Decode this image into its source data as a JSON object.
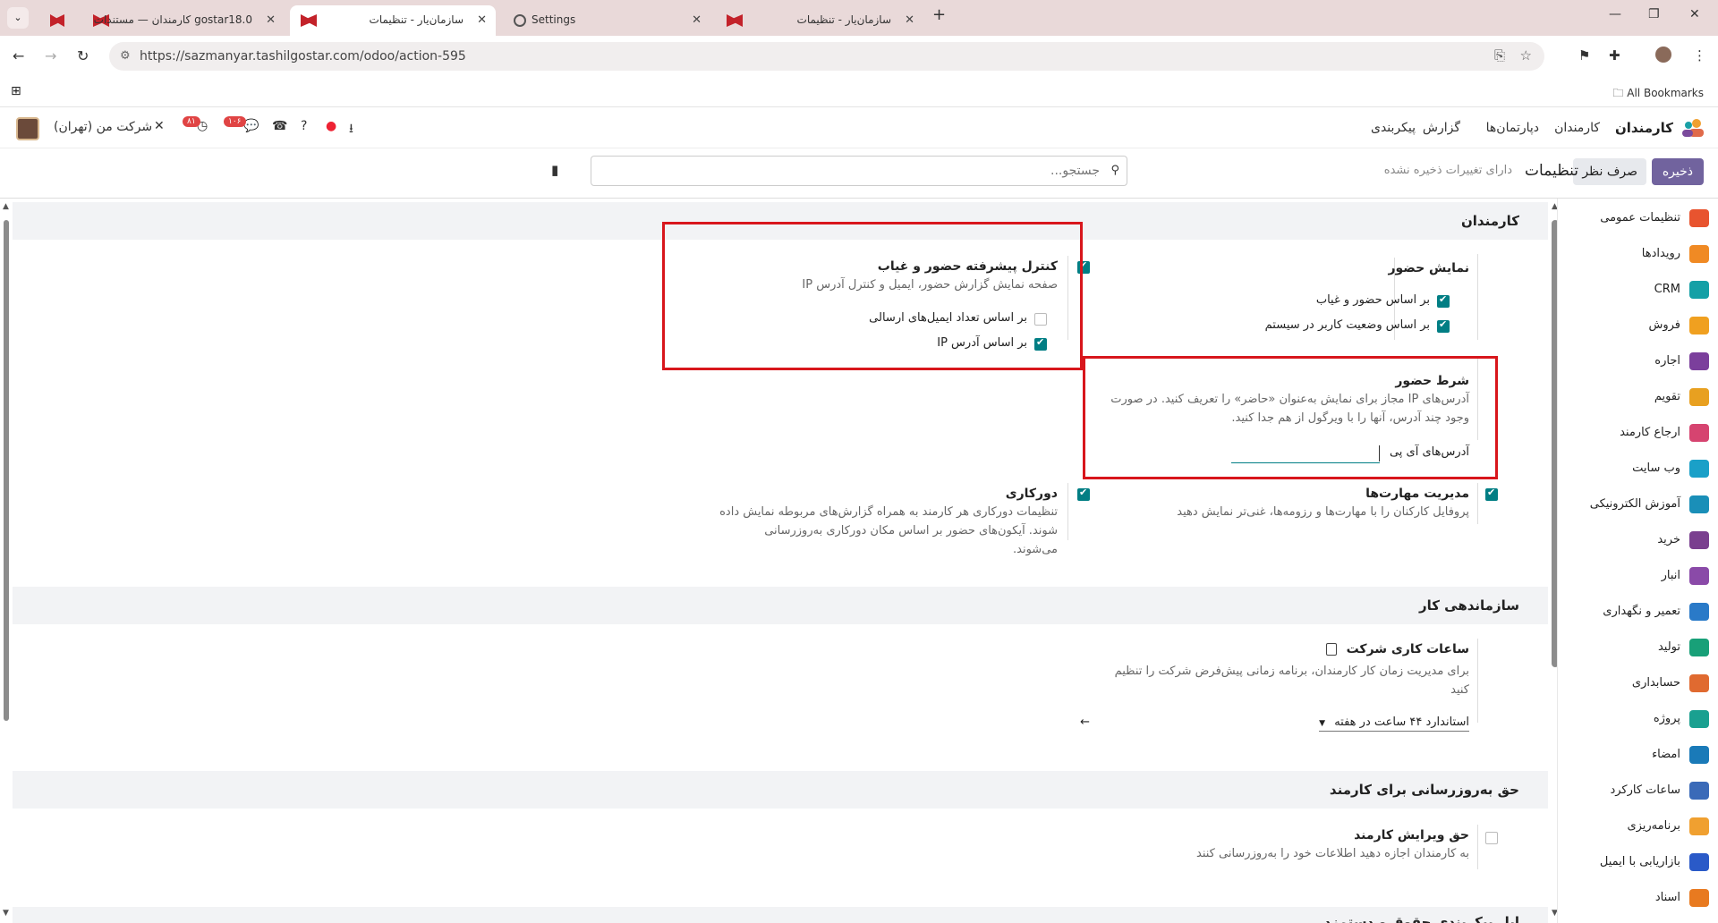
{
  "browser": {
    "tabs": [
      {
        "title": "gostar18.0 کارمندان — مستندات"
      },
      {
        "title": "سازمان‌یار - تنظیمات"
      },
      {
        "title": "Settings"
      },
      {
        "title": "سازمان‌یار - تنظیمات"
      }
    ],
    "new_tab": "+",
    "url": "https://sazmanyar.tashilgostar.com/odoo/action-595",
    "all_bookmarks": "All Bookmarks"
  },
  "topnav": {
    "brand": "کارمندان",
    "menu": [
      "کارمندان",
      "دپارتمان‌ها",
      "گزارش",
      "پیکربندی"
    ],
    "badge_messages": "۱۰۶",
    "badge_activities": "۸۱",
    "company": "شرکت من (تهران)"
  },
  "control": {
    "save": "ذخیره",
    "discard": "صرف نظر",
    "title": "تنظیمات",
    "unsaved": "دارای تغییرات ذخیره نشده",
    "search_placeholder": "جستجو..."
  },
  "sidebar": {
    "items": [
      {
        "label": "تنظیمات عمومی",
        "color": "#e8542f"
      },
      {
        "label": "رویدادها",
        "color": "#f08a24"
      },
      {
        "label": "CRM",
        "color": "#14a0a6"
      },
      {
        "label": "فروش",
        "color": "#f0a020"
      },
      {
        "label": "اجاره",
        "color": "#7b3f9c"
      },
      {
        "label": "تقویم",
        "color": "#e8a020"
      },
      {
        "label": "ارجاع کارمند",
        "color": "#d64470"
      },
      {
        "label": "وب سایت",
        "color": "#1aa0c8"
      },
      {
        "label": "آموزش الکترونیکی",
        "color": "#1a8fb8"
      },
      {
        "label": "خرید",
        "color": "#7a3f8f"
      },
      {
        "label": "انبار",
        "color": "#8a4aa8"
      },
      {
        "label": "تعمیر و نگهداری",
        "color": "#2a7ac8"
      },
      {
        "label": "تولید",
        "color": "#18a078"
      },
      {
        "label": "حسابداری",
        "color": "#e06a30"
      },
      {
        "label": "پروژه",
        "color": "#1aa090"
      },
      {
        "label": "امضاء",
        "color": "#1a7ab8"
      },
      {
        "label": "ساعات کارکرد",
        "color": "#3a6ab8"
      },
      {
        "label": "برنامه‌ریزی",
        "color": "#f0a030"
      },
      {
        "label": "بازاریابی با ایمیل",
        "color": "#2a5ac8"
      },
      {
        "label": "اسناد",
        "color": "#e87a20"
      }
    ]
  },
  "sections": {
    "employees": "کارمندان",
    "work_organization": "سازماندهی کار",
    "employee_update_rights": "حق به‌روزرسانی برای کارمند",
    "next_section_partial": "ایل پیکربندی حقوق و دستمزد"
  },
  "presence_display": {
    "title": "نمایش حضور",
    "option1": "بر اساس حضور و غیاب",
    "option2": "بر اساس وضعیت کاربر در سیستم"
  },
  "advanced_presence": {
    "title": "کنترل پیشرفته حضور و غیاب",
    "desc": "صفحه نمایش گزارش حضور، ایمیل و کنترل آدرس IP",
    "option1": "بر اساس تعداد ایمیل‌های ارسالی",
    "option2": "بر اساس آدرس IP"
  },
  "presence_condition": {
    "title": "شرط حضور",
    "desc": "آدرس‌های IP مجاز برای نمایش به‌عنوان «حاضر» را تعریف کنید. در صورت وجود چند آدرس، آنها را با ویرگول از هم جدا کنید.",
    "field_label": "آدرس‌های آی پی"
  },
  "skills": {
    "title": "مدیریت مهارت‌ها",
    "desc": "پروفایل کارکنان را با مهارت‌ها و رزومه‌ها، غنی‌تر نمایش دهید"
  },
  "remote_work": {
    "title": "دورکاری",
    "desc": "تنظیمات دورکاری هر کارمند به همراه گزارش‌های مربوطه نمایش داده شوند. آیکون‌های حضور بر اساس مکان دورکاری به‌روزرسانی می‌شوند."
  },
  "working_hours": {
    "title": "ساعات کاری شرکت",
    "desc": "برای مدیریت زمان کار کارمندان، برنامه زمانی پیش‌فرض شرکت را تنظیم کنید",
    "value": "استاندارد ۴۴ ساعت در هفته"
  },
  "edit_rights": {
    "title": "حق ویرایش کارمند",
    "desc": "به کارمندان اجازه دهید اطلاعات خود را به‌روزرسانی کنند"
  }
}
